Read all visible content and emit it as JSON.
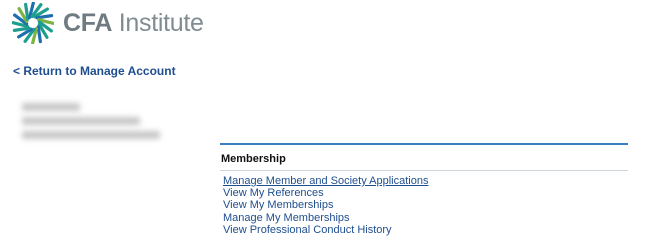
{
  "brand": {
    "logo_icon": "cfa-starburst-logo",
    "name_bold": "CFA",
    "name_rest": " Institute",
    "colors": {
      "logo_teal": "#1d9e8e",
      "logo_blue": "#1f6fb0",
      "logo_green": "#7cb342",
      "text_gray": "#7f8c90"
    }
  },
  "nav": {
    "return_label": "< Return to Manage Account"
  },
  "membership": {
    "header": "Membership",
    "accent_color": "#3b7fc0",
    "links": [
      {
        "label": "Manage Member and Society Applications"
      },
      {
        "label": "View My References"
      },
      {
        "label": "View My Memberships"
      },
      {
        "label": "Manage My Memberships"
      },
      {
        "label": "View Professional Conduct History"
      }
    ]
  }
}
